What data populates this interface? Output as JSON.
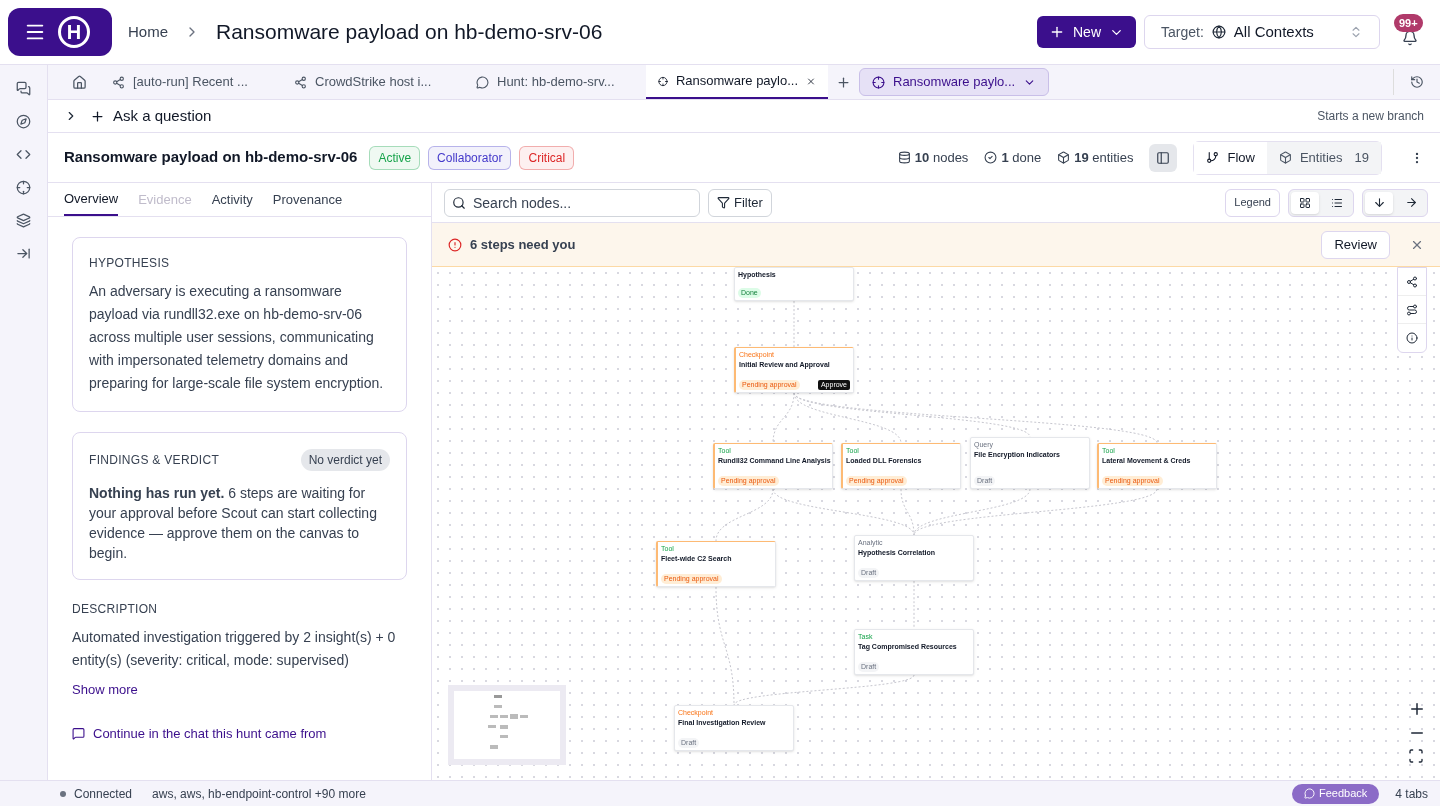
{
  "header": {
    "logo": "H",
    "breadcrumb": "Home",
    "title": "Ransomware payload on hb-demo-srv-06",
    "new_button": "New",
    "target_label": "Target:",
    "target_value": "All Contexts",
    "notifications": "99+"
  },
  "tabs": [
    {
      "kind": "home",
      "selected": false
    },
    {
      "kind": "flow",
      "label": "[auto-run] Recent ...",
      "selected": false
    },
    {
      "kind": "flow",
      "label": "CrowdStrike host i...",
      "selected": false
    },
    {
      "kind": "chat",
      "label": "Hunt: hb-demo-srv...",
      "selected": false
    },
    {
      "kind": "target",
      "label": "Ransomware paylo...",
      "selected": true
    }
  ],
  "tab_dropdown": "Ransomware paylo...",
  "ask": {
    "label": "Ask a question",
    "hint": "Starts a new branch"
  },
  "hunt": {
    "title": "Ransomware payload on hb-demo-srv-06",
    "badges": [
      {
        "label": "Active",
        "color": "#16a34a"
      },
      {
        "label": "Collaborator",
        "color": "#4338ca"
      },
      {
        "label": "Critical",
        "color": "#dc2626"
      }
    ],
    "stats": [
      {
        "kind": "nodes",
        "text": "**10** nodes"
      },
      {
        "kind": "done",
        "text": "**1** done"
      },
      {
        "kind": "entities",
        "text": "**19** entities"
      }
    ],
    "views": [
      {
        "kind": "flow",
        "label": "Flow",
        "selected": true
      },
      {
        "kind": "entities",
        "label": "Entities",
        "count": "19",
        "selected": false
      }
    ]
  },
  "panel_tabs": [
    {
      "label": "Overview",
      "selected": true,
      "disabled": false
    },
    {
      "label": "Evidence",
      "selected": false,
      "disabled": true
    },
    {
      "label": "Activity",
      "selected": false,
      "disabled": false
    },
    {
      "label": "Provenance",
      "selected": false,
      "disabled": false
    }
  ],
  "hypothesis": {
    "heading": "HYPOTHESIS",
    "text": "An adversary is executing a ransomware payload via rundll32.exe on hb-demo-srv-06 across multiple user sessions, communicating with impersonated telemetry domains and preparing for large-scale file system encryption."
  },
  "findings": {
    "heading": "FINDINGS & VERDICT",
    "verdict": "No verdict yet",
    "text": "**Nothing has run yet.** 6 steps are waiting for your approval before Scout can start collecting evidence — approve them on the canvas to begin."
  },
  "description": {
    "heading": "DESCRIPTION",
    "text": "Automated investigation triggered by 2 insight(s) + 0 entity(s) (severity: critical, mode: supervised)",
    "show_more": "Show more"
  },
  "chat_link": "Continue in the chat this hunt came from",
  "canvas": {
    "search_placeholder": "Search nodes...",
    "filter": "Filter",
    "legend": "Legend",
    "layouts": [
      {
        "kind": "grid",
        "selected": true
      },
      {
        "kind": "list",
        "selected": false
      }
    ],
    "directions": [
      {
        "kind": "down",
        "selected": true
      },
      {
        "kind": "right",
        "selected": false
      }
    ],
    "banner": {
      "text": "6 steps need you",
      "button": "Review"
    },
    "nodes": [
      {
        "kind": "hypothesis",
        "title": "Hypothesis",
        "status": "Done"
      },
      {
        "kind": "checkpoint",
        "label": "Checkpoint",
        "title": "Initial Review and Approval",
        "status": "Pending approval",
        "action": "Approve"
      },
      {
        "kind": "tool",
        "label": "Tool",
        "title": "Rundll32 Command Line Analysis",
        "status": "Pending approval"
      },
      {
        "kind": "tool",
        "label": "Tool",
        "title": "Loaded DLL Forensics",
        "status": "Pending approval"
      },
      {
        "kind": "query",
        "label": "Query",
        "title": "File Encryption Indicators",
        "status": "Draft"
      },
      {
        "kind": "tool",
        "label": "Tool",
        "title": "Lateral Movement & Creds",
        "status": "Pending approval"
      },
      {
        "kind": "tool",
        "label": "Tool",
        "title": "Fleet-wide C2 Search",
        "status": "Pending approval"
      },
      {
        "kind": "analytic",
        "label": "Analytic",
        "title": "Hypothesis Correlation",
        "status": "Draft"
      },
      {
        "kind": "task",
        "label": "Task",
        "title": "Tag Compromised Resources",
        "status": "Draft"
      },
      {
        "kind": "checkpoint",
        "label": "Checkpoint",
        "title": "Final Investigation Review",
        "status": "Draft"
      }
    ]
  },
  "status_bar": {
    "connection": "Connected",
    "sources": "aws, aws, hb-endpoint-control +90 more",
    "tabs": "4 tabs",
    "feedback": "Feedback"
  }
}
